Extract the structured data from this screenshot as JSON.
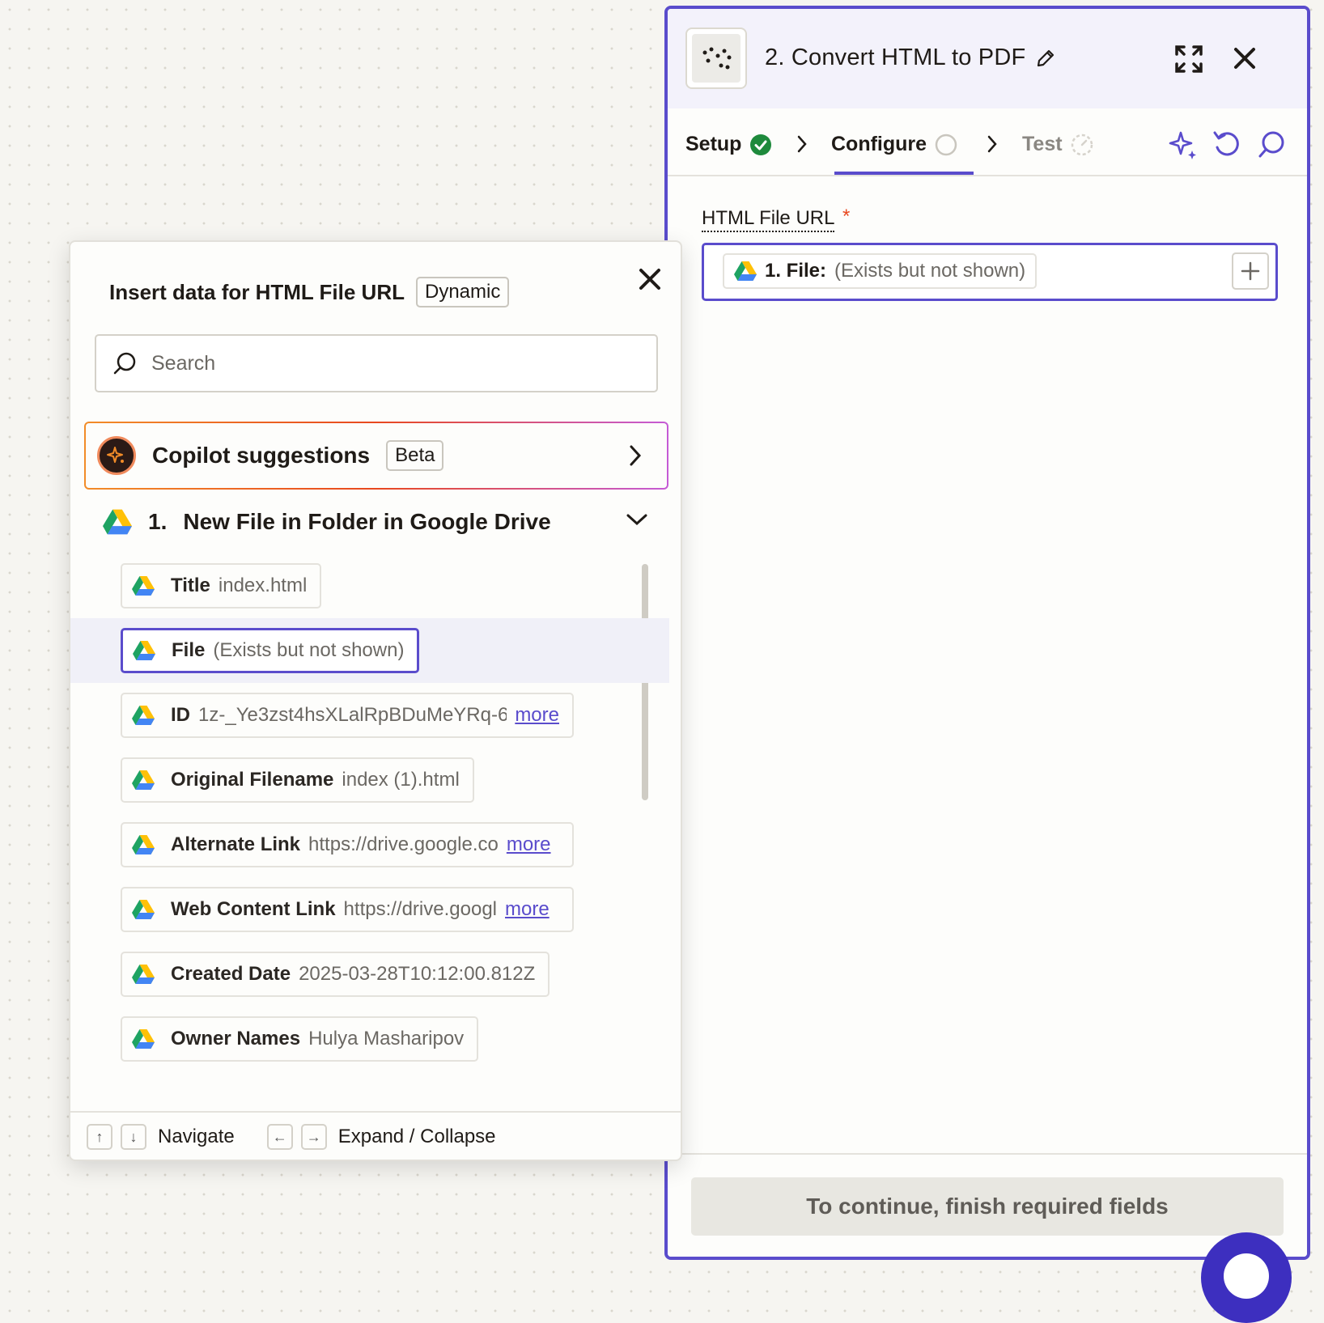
{
  "step_panel": {
    "title": "2. Convert HTML to PDF",
    "tabs": [
      {
        "label": "Setup",
        "status": "complete"
      },
      {
        "label": "Configure",
        "status": "pending"
      },
      {
        "label": "Test",
        "status": "disabled"
      }
    ],
    "field": {
      "label": "HTML File URL",
      "required_marker": "*",
      "chip_key": "1. File:",
      "chip_value": "(Exists but not shown)"
    },
    "continue_button": "To continue, finish required fields"
  },
  "popover": {
    "title": "Insert data for HTML File URL",
    "title_badge": "Dynamic",
    "search_placeholder": "Search",
    "copilot": {
      "label": "Copilot suggestions",
      "badge": "Beta"
    },
    "group": {
      "number": "1.",
      "title": "New File in Folder in Google Drive"
    },
    "items": [
      {
        "key": "Title",
        "value": "index.html",
        "more": ""
      },
      {
        "key": "File",
        "value": "(Exists but not shown)",
        "more": ""
      },
      {
        "key": "ID",
        "value": "1z-_Ye3zst4hsXLalRpBDuMeYRq-6",
        "more": "more"
      },
      {
        "key": "Original Filename",
        "value": "index (1).html",
        "more": ""
      },
      {
        "key": "Alternate Link",
        "value": "https://drive.google.co",
        "more": "more"
      },
      {
        "key": "Web Content Link",
        "value": "https://drive.googl",
        "more": "more"
      },
      {
        "key": "Created Date",
        "value": "2025-03-28T10:12:00.812Z",
        "more": ""
      },
      {
        "key": "Owner Names",
        "value": "Hulya Masharipov",
        "more": ""
      }
    ],
    "footer": {
      "up_key": "↑",
      "down_key": "↓",
      "navigate_label": "Navigate",
      "left_key": "←",
      "right_key": "→",
      "expand_label": "Expand / Collapse"
    }
  },
  "colors": {
    "accent": "#5a4ccc",
    "required": "#e8481f",
    "success": "#1e8a3c"
  }
}
